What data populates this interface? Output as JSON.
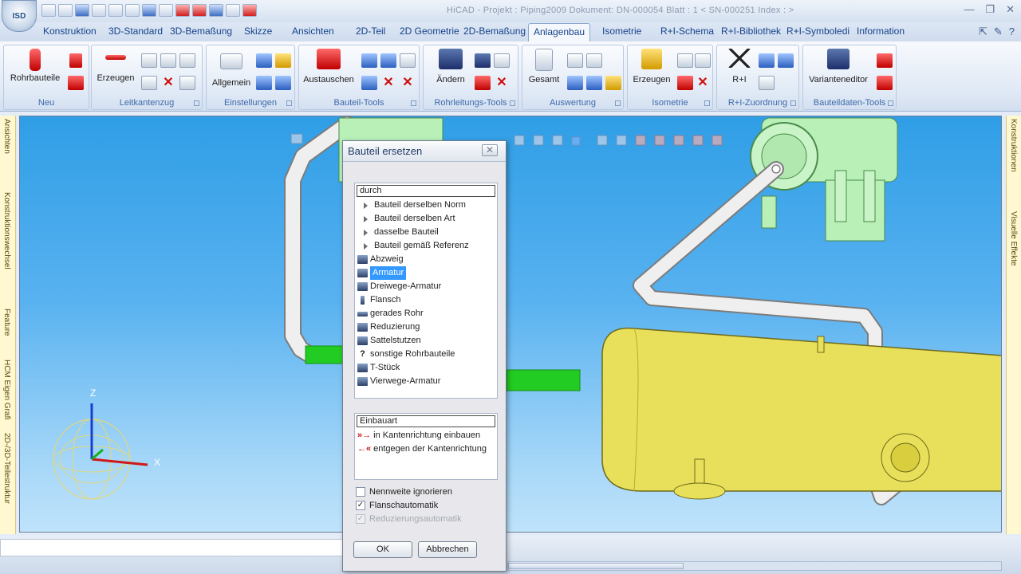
{
  "window": {
    "app_button": "ISD",
    "title": "HiCAD - Projekt : Piping2009  Dokument: DN-000054  Blatt : 1    < SN-000251  Index : >",
    "controls": [
      "—",
      "❐",
      "✕"
    ]
  },
  "tabs": [
    {
      "label": "Konstruktion"
    },
    {
      "label": "3D-Standard"
    },
    {
      "label": "3D-Bemaßung"
    },
    {
      "label": "Skizze"
    },
    {
      "label": "Ansichten"
    },
    {
      "label": "2D-Teil"
    },
    {
      "label": "2D Geometrie"
    },
    {
      "label": "2D-Bemaßung"
    },
    {
      "label": "Anlagenbau",
      "active": true
    },
    {
      "label": "Isometrie"
    },
    {
      "label": "R+I-Schema"
    },
    {
      "label": "R+I-Bibliothek"
    },
    {
      "label": "R+I-Symboledi"
    },
    {
      "label": "Information"
    }
  ],
  "ribbon": {
    "groups": [
      {
        "label": "Neu",
        "big": [
          "Rohrbauteile"
        ]
      },
      {
        "label": "Leitkantenzug",
        "big": [
          "Erzeugen"
        ]
      },
      {
        "label": "Einstellungen",
        "big": [
          "Allgemein"
        ]
      },
      {
        "label": "Bauteil-Tools",
        "big": [
          "Austauschen"
        ]
      },
      {
        "label": "Rohrleitungs-Tools",
        "big": [
          "Ändern"
        ]
      },
      {
        "label": "Auswertung",
        "big": [
          "Gesamt"
        ]
      },
      {
        "label": "Isometrie",
        "big": [
          "Erzeugen"
        ]
      },
      {
        "label": "R+I-Zuordnung",
        "big": [
          "R+I"
        ]
      },
      {
        "label": "Bauteildaten-Tools",
        "big": [
          "Varianteneditor"
        ]
      }
    ]
  },
  "docks": {
    "left": [
      "Ansichten",
      "Konstruktionswechsel",
      "Feature",
      "HCM Eigen Grafi",
      "2D-/3D-Teilestruktur"
    ],
    "right": [
      "Konstruktionen",
      "Visuelle Effekte"
    ]
  },
  "viewport": {
    "axes": {
      "z": "Z",
      "x": "X"
    }
  },
  "dialog": {
    "title": "Bauteil ersetzen",
    "close": "✕",
    "list1_header": "durch",
    "list1_items": [
      {
        "label": "Bauteil derselben Norm",
        "kind": "expand"
      },
      {
        "label": "Bauteil derselben Art",
        "kind": "expand"
      },
      {
        "label": "dasselbe Bauteil",
        "kind": "expand"
      },
      {
        "label": "Bauteil gemäß Referenz",
        "kind": "expand"
      },
      {
        "label": "Abzweig",
        "kind": "icon"
      },
      {
        "label": "Armatur",
        "kind": "icon",
        "selected": true
      },
      {
        "label": "Dreiwege-Armatur",
        "kind": "icon"
      },
      {
        "label": "Flansch",
        "kind": "icon"
      },
      {
        "label": "gerades Rohr",
        "kind": "icon"
      },
      {
        "label": "Reduzierung",
        "kind": "icon"
      },
      {
        "label": "Sattelstutzen",
        "kind": "icon"
      },
      {
        "label": "sonstige Rohrbauteile",
        "kind": "question"
      },
      {
        "label": "T-Stück",
        "kind": "icon"
      },
      {
        "label": "Vierwege-Armatur",
        "kind": "icon"
      }
    ],
    "list2_header": "Einbauart",
    "list2_items": [
      "in Kantenrichtung einbauen",
      "entgegen der Kantenrichtung"
    ],
    "checkboxes": [
      {
        "label": "Nennweite ignorieren",
        "checked": false,
        "disabled": false
      },
      {
        "label": "Flanschautomatik",
        "checked": true,
        "disabled": false
      },
      {
        "label": "Reduzierungsautomatik",
        "checked": true,
        "disabled": true
      }
    ],
    "ok": "OK",
    "cancel": "Abbrechen"
  },
  "colors": {
    "pipe_green": "#22cc22",
    "vessel_yellow": "#e8e05a",
    "pump_green": "#b8f0b8",
    "pipe_gray": "#ececec",
    "sky_top": "#2f9ee6"
  }
}
